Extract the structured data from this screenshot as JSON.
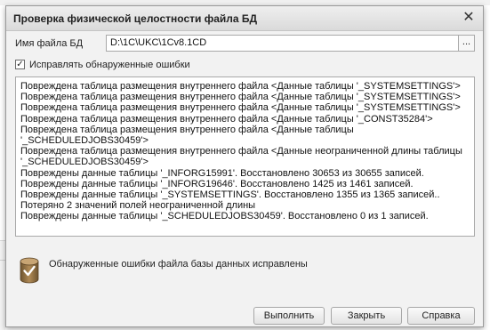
{
  "dialog": {
    "title": "Проверка физической целостности файла БД",
    "close_glyph": "✕"
  },
  "filename": {
    "label": "Имя файла БД",
    "value": "D:\\1C\\UKC\\1Cv8.1CD",
    "browse_label": "..."
  },
  "fix_errors": {
    "label": "Исправлять обнаруженные ошибки",
    "checked": true,
    "check_glyph": "✓"
  },
  "log": {
    "lines": [
      "Повреждена таблица размещения внутреннего файла <Данные таблицы '_SYSTEMSETTINGS'>",
      "Повреждена таблица размещения внутреннего файла <Данные таблицы '_SYSTEMSETTINGS'>",
      "Повреждена таблица размещения внутреннего файла <Данные таблицы '_SYSTEMSETTINGS'>",
      "Повреждена таблица размещения внутреннего файла <Данные таблицы '_CONST35284'>",
      "Повреждена таблица размещения внутреннего файла <Данные таблицы",
      "'_SCHEDULEDJOBS30459'>",
      "Повреждена таблица размещения внутреннего файла <Данные неограниченной длины таблицы",
      "'_SCHEDULEDJOBS30459'>",
      "Повреждены данные таблицы '_INFORG15991'. Восстановлено 30653 из 30655 записей.",
      "Повреждены данные таблицы '_INFORG19646'. Восстановлено 1425 из 1461 записей.",
      "Повреждены данные таблицы '_SYSTEMSETTINGS'. Восстановлено 1355 из 1365 записей..",
      "Потеряно 2 значений полей неограниченной длины",
      "Повреждены данные таблицы '_SCHEDULEDJOBS30459'. Восстановлено 0 из 1 записей."
    ]
  },
  "status": {
    "icon": "database-check-icon",
    "text": "Обнаруженные ошибки файла базы данных исправлены"
  },
  "buttons": {
    "run_label": "Выполнить",
    "close_label": "Закрыть",
    "help_label": "Справка"
  },
  "colors": {
    "dialog_bg": "#f2f2f2",
    "icon_brown": "#8a6a3c"
  }
}
